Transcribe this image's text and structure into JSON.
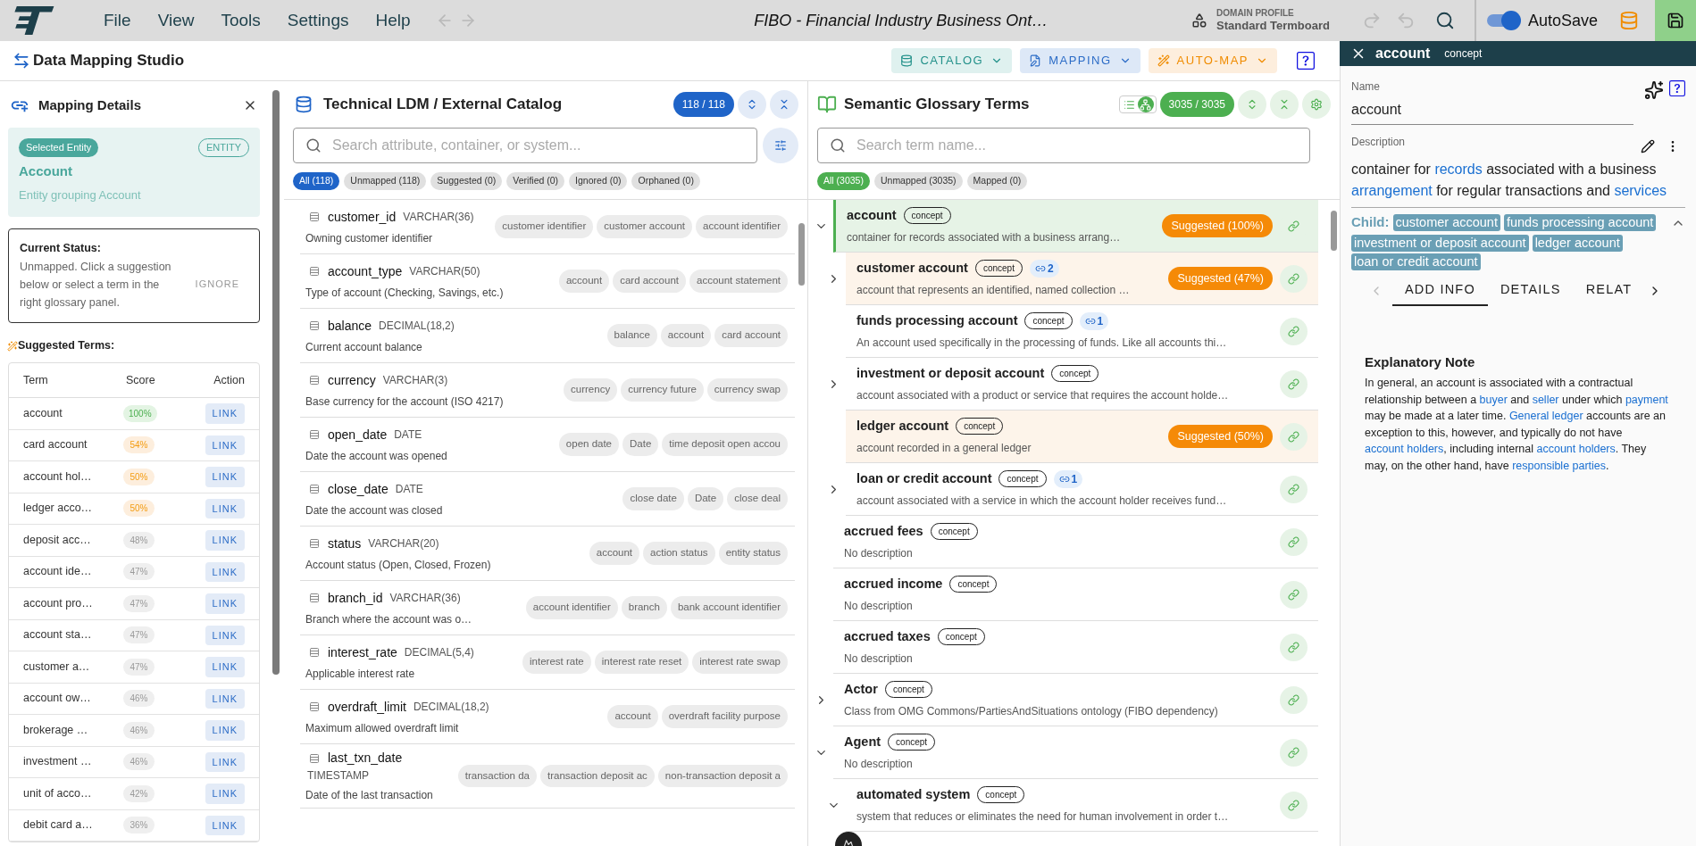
{
  "menu_bar": {
    "menu": [
      "File",
      "View",
      "Tools",
      "Settings",
      "Help"
    ],
    "document_title": "FIBO - Financial Industry Business Ont…",
    "domain_profile": {
      "label": "DOMAIN PROFILE",
      "value": "Standard Termboard"
    },
    "autosave": {
      "label": "AutoSave",
      "on": true
    }
  },
  "toolbar": {
    "title": "Data Mapping Studio",
    "buttons": [
      {
        "label": "CATALOG",
        "kind": "catalog"
      },
      {
        "label": "MAPPING",
        "kind": "mapping"
      },
      {
        "label": "AUTO-MAP",
        "kind": "automap"
      }
    ]
  },
  "mapping_details": {
    "title": "Mapping Details",
    "entity": {
      "badge": "Selected Entity",
      "type": "ENTITY",
      "name": "Account",
      "description": "Entity grouping Account"
    },
    "status": {
      "title": "Current Status:",
      "text": "Unmapped. Click a suggestion below or select a term in the right glossary panel.",
      "action": "IGNORE"
    },
    "suggested_title": "Suggested Terms:",
    "columns": [
      "Term",
      "Score",
      "Action"
    ],
    "suggestions": [
      {
        "term": "account",
        "score": "100%",
        "kind": "high",
        "action": "LINK"
      },
      {
        "term": "card account",
        "score": "54%",
        "kind": "medium",
        "action": "LINK"
      },
      {
        "term": "account hol…",
        "score": "50%",
        "kind": "medium",
        "action": "LINK"
      },
      {
        "term": "ledger acco…",
        "score": "50%",
        "kind": "medium",
        "action": "LINK"
      },
      {
        "term": "deposit acc…",
        "score": "48%",
        "kind": "low",
        "action": "LINK"
      },
      {
        "term": "account ide…",
        "score": "47%",
        "kind": "low",
        "action": "LINK"
      },
      {
        "term": "account pro…",
        "score": "47%",
        "kind": "low",
        "action": "LINK"
      },
      {
        "term": "account sta…",
        "score": "47%",
        "kind": "low",
        "action": "LINK"
      },
      {
        "term": "customer a…",
        "score": "47%",
        "kind": "low",
        "action": "LINK"
      },
      {
        "term": "account ow…",
        "score": "46%",
        "kind": "low",
        "action": "LINK"
      },
      {
        "term": "brokerage …",
        "score": "46%",
        "kind": "low",
        "action": "LINK"
      },
      {
        "term": "investment …",
        "score": "46%",
        "kind": "low",
        "action": "LINK"
      },
      {
        "term": "unit of acco…",
        "score": "42%",
        "kind": "low",
        "action": "LINK"
      },
      {
        "term": "debit card a…",
        "score": "36%",
        "kind": "low",
        "action": "LINK"
      }
    ]
  },
  "catalog": {
    "title": "Technical LDM / External Catalog",
    "count": "118 / 118",
    "search_placeholder": "Search attribute, container, or system...",
    "filters": [
      {
        "label": "All (118)",
        "selected": true
      },
      {
        "label": "Unmapped (118)",
        "selected": false
      },
      {
        "label": "Suggested (0)",
        "selected": false
      },
      {
        "label": "Verified (0)",
        "selected": false
      },
      {
        "label": "Ignored (0)",
        "selected": false
      },
      {
        "label": "Orphaned (0)",
        "selected": false
      }
    ],
    "attributes": [
      {
        "name": "customer_id",
        "type": "VARCHAR(36)",
        "description": "Owning customer identifier",
        "suggestions": [
          "customer identifier",
          "customer account",
          "account identifier"
        ]
      },
      {
        "name": "account_type",
        "type": "VARCHAR(50)",
        "description": "Type of account (Checking, Savings, etc.)",
        "suggestions": [
          "account",
          "card account",
          "account statement"
        ]
      },
      {
        "name": "balance",
        "type": "DECIMAL(18,2)",
        "description": "Current account balance",
        "suggestions": [
          "balance",
          "account",
          "card account"
        ]
      },
      {
        "name": "currency",
        "type": "VARCHAR(3)",
        "description": "Base currency for the account (ISO 4217)",
        "suggestions": [
          "currency",
          "currency future",
          "currency swap"
        ]
      },
      {
        "name": "open_date",
        "type": "DATE",
        "description": "Date the account was opened",
        "suggestions": [
          "open date",
          "Date",
          "time deposit open accou"
        ]
      },
      {
        "name": "close_date",
        "type": "DATE",
        "description": "Date the account was closed",
        "suggestions": [
          "close date",
          "Date",
          "close deal"
        ]
      },
      {
        "name": "status",
        "type": "VARCHAR(20)",
        "description": "Account status (Open, Closed, Frozen)",
        "suggestions": [
          "account",
          "action status",
          "entity status"
        ]
      },
      {
        "name": "branch_id",
        "type": "VARCHAR(36)",
        "description": "Branch where the account was o…",
        "suggestions": [
          "account identifier",
          "branch",
          "bank account identifier"
        ]
      },
      {
        "name": "interest_rate",
        "type": "DECIMAL(5,4)",
        "description": "Applicable interest rate",
        "suggestions": [
          "interest rate",
          "interest rate reset",
          "interest rate swap"
        ]
      },
      {
        "name": "overdraft_limit",
        "type": "DECIMAL(18,2)",
        "description": "Maximum allowed overdraft limit",
        "suggestions": [
          "account",
          "overdraft facility purpose"
        ]
      },
      {
        "name": "last_txn_date",
        "type": "TIMESTAMP",
        "description": "Date of the last transaction",
        "suggestions": [
          "transaction da",
          "transaction deposit ac",
          "non-transaction deposit a"
        ]
      }
    ]
  },
  "glossary": {
    "title": "Semantic Glossary Terms",
    "view_modes": [
      {
        "kind": "list",
        "selected": false
      },
      {
        "kind": "tree",
        "selected": true
      }
    ],
    "count": "3035 / 3035",
    "search_placeholder": "Search term name...",
    "filters": [
      {
        "label": "All (3035)",
        "selected": true
      },
      {
        "label": "Unmapped (3035)",
        "selected": false
      },
      {
        "label": "Mapped (0)",
        "selected": false
      }
    ],
    "terms": [
      {
        "name": "account",
        "badge": "concept",
        "description": "container for records associated with a business arrang…",
        "suggestion": "Suggested (100%)",
        "selected": true,
        "kind": "branch",
        "expanded": true,
        "children": [
          {
            "name": "customer account",
            "badge": "concept",
            "links": "2",
            "description": "account that represents an identified, named collection …",
            "suggestion": "Suggested (47%)",
            "selected": false,
            "kind": "branch",
            "expanded": false
          },
          {
            "name": "funds processing account",
            "badge": "concept",
            "links": "1",
            "description": "An account used specifically in the processing of funds. Like all accounts thi…",
            "selected": false,
            "kind": "leaf"
          },
          {
            "name": "investment or deposit account",
            "badge": "concept",
            "description": "account associated with a product or service that requires the account holde…",
            "selected": false,
            "kind": "branch",
            "expanded": false
          },
          {
            "name": "ledger account",
            "badge": "concept",
            "description": "account recorded in a general ledger",
            "suggestion": "Suggested (50%)",
            "selected": false,
            "kind": "leaf"
          },
          {
            "name": "loan or credit account",
            "badge": "concept",
            "links": "1",
            "description": "account associated with a service in which the account holder receives fund…",
            "selected": false,
            "kind": "branch",
            "expanded": false
          }
        ]
      },
      {
        "name": "accrued fees",
        "badge": "concept",
        "description": "No description",
        "selected": false,
        "kind": "leaf"
      },
      {
        "name": "accrued income",
        "badge": "concept",
        "description": "No description",
        "selected": false,
        "kind": "leaf"
      },
      {
        "name": "accrued taxes",
        "badge": "concept",
        "description": "No description",
        "selected": false,
        "kind": "leaf"
      },
      {
        "name": "Actor",
        "badge": "concept",
        "description": "Class from OMG Commons/PartiesAndSituations ontology (FIBO dependency)",
        "selected": false,
        "kind": "branch",
        "expanded": false
      },
      {
        "name": "Agent",
        "badge": "concept",
        "description": "No description",
        "selected": false,
        "kind": "branch",
        "expanded": true,
        "children": [
          {
            "name": "automated system",
            "badge": "concept",
            "description": "system that reduces or eliminates the need for human involvement in order t…",
            "selected": false,
            "kind": "branch",
            "expanded": true
          }
        ]
      }
    ]
  },
  "term_panel": {
    "title": "account",
    "type": "concept",
    "name_label": "Name",
    "name_value": "account",
    "description_label": "Description",
    "description": [
      {
        "kind": "text",
        "text": "container for "
      },
      {
        "kind": "link",
        "text": "records"
      },
      {
        "kind": "text",
        "text": " associated with a business "
      },
      {
        "kind": "link",
        "text": "arrangement"
      },
      {
        "kind": "text",
        "text": " for regular transactions and "
      },
      {
        "kind": "link",
        "text": "services"
      }
    ],
    "child_label": "Child:",
    "children": [
      "customer account",
      "funds processing account",
      "investment or deposit account",
      "ledger account",
      "loan or credit account"
    ],
    "tabs": [
      {
        "label": "ADD INFO",
        "selected": true
      },
      {
        "label": "DETAILS",
        "selected": false
      },
      {
        "label": "RELAT",
        "selected": false
      }
    ],
    "note_title": "Explanatory Note",
    "note": [
      {
        "kind": "text",
        "text": "In general, an account is associated with a contractual relationship between a "
      },
      {
        "kind": "link",
        "text": "buyer"
      },
      {
        "kind": "text",
        "text": " and "
      },
      {
        "kind": "link",
        "text": "seller"
      },
      {
        "kind": "text",
        "text": " under which "
      },
      {
        "kind": "link",
        "text": "payment"
      },
      {
        "kind": "text",
        "text": " may be made at a later time. "
      },
      {
        "kind": "link",
        "text": "General ledger"
      },
      {
        "kind": "text",
        "text": " accounts are an exception to this, however, and typically do not have "
      },
      {
        "kind": "link",
        "text": "account holders"
      },
      {
        "kind": "text",
        "text": ", including internal "
      },
      {
        "kind": "link",
        "text": "account holders"
      },
      {
        "kind": "text",
        "text": ". They may, on the other hand, have "
      },
      {
        "kind": "link",
        "text": "responsible parties"
      },
      {
        "kind": "text",
        "text": "."
      }
    ]
  }
}
